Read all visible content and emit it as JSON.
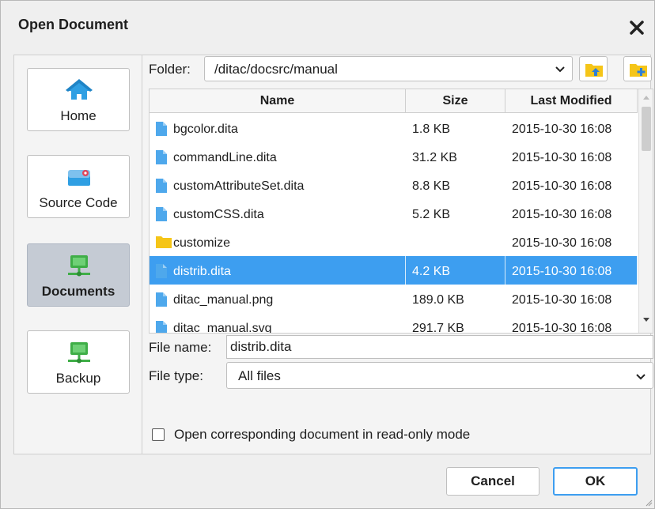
{
  "window": {
    "title": "Open Document"
  },
  "sidebar": {
    "items": [
      {
        "label": "Home",
        "icon": "home-icon",
        "active": false
      },
      {
        "label": "Source Code",
        "icon": "drive-icon",
        "active": false
      },
      {
        "label": "Documents",
        "icon": "network-drive-icon",
        "active": true
      },
      {
        "label": "Backup",
        "icon": "network-drive-icon",
        "active": false
      }
    ]
  },
  "folder": {
    "label": "Folder:",
    "value": "/ditac/docsrc/manual"
  },
  "columns": {
    "name": "Name",
    "size": "Size",
    "modified": "Last Modified"
  },
  "files": [
    {
      "name": "bgcolor.dita",
      "size": "1.8 KB",
      "modified": "2015-10-30 16:08",
      "type": "file"
    },
    {
      "name": "commandLine.dita",
      "size": "31.2 KB",
      "modified": "2015-10-30 16:08",
      "type": "file"
    },
    {
      "name": "customAttributeSet.dita",
      "size": "8.8 KB",
      "modified": "2015-10-30 16:08",
      "type": "file"
    },
    {
      "name": "customCSS.dita",
      "size": "5.2 KB",
      "modified": "2015-10-30 16:08",
      "type": "file"
    },
    {
      "name": "customize",
      "size": "",
      "modified": "2015-10-30 16:08",
      "type": "folder"
    },
    {
      "name": "distrib.dita",
      "size": "4.2 KB",
      "modified": "2015-10-30 16:08",
      "type": "file"
    },
    {
      "name": "ditac_manual.png",
      "size": "189.0 KB",
      "modified": "2015-10-30 16:08",
      "type": "file"
    },
    {
      "name": "ditac_manual.svg",
      "size": "291.7 KB",
      "modified": "2015-10-30 16:08",
      "type": "file"
    }
  ],
  "selected_index": 5,
  "filename": {
    "label": "File name:",
    "value": "distrib.dita"
  },
  "filetype": {
    "label": "File type:",
    "value": "All files"
  },
  "readonly": {
    "label": "Open corresponding document in read-only mode",
    "checked": false
  },
  "buttons": {
    "cancel": "Cancel",
    "ok": "OK"
  },
  "colors": {
    "selection": "#3d9ef0",
    "file_icon": "#4ea8ec",
    "folder_icon": "#f5c518",
    "network_icon": "#3fae47",
    "home_icon": "#2f9fe3"
  }
}
